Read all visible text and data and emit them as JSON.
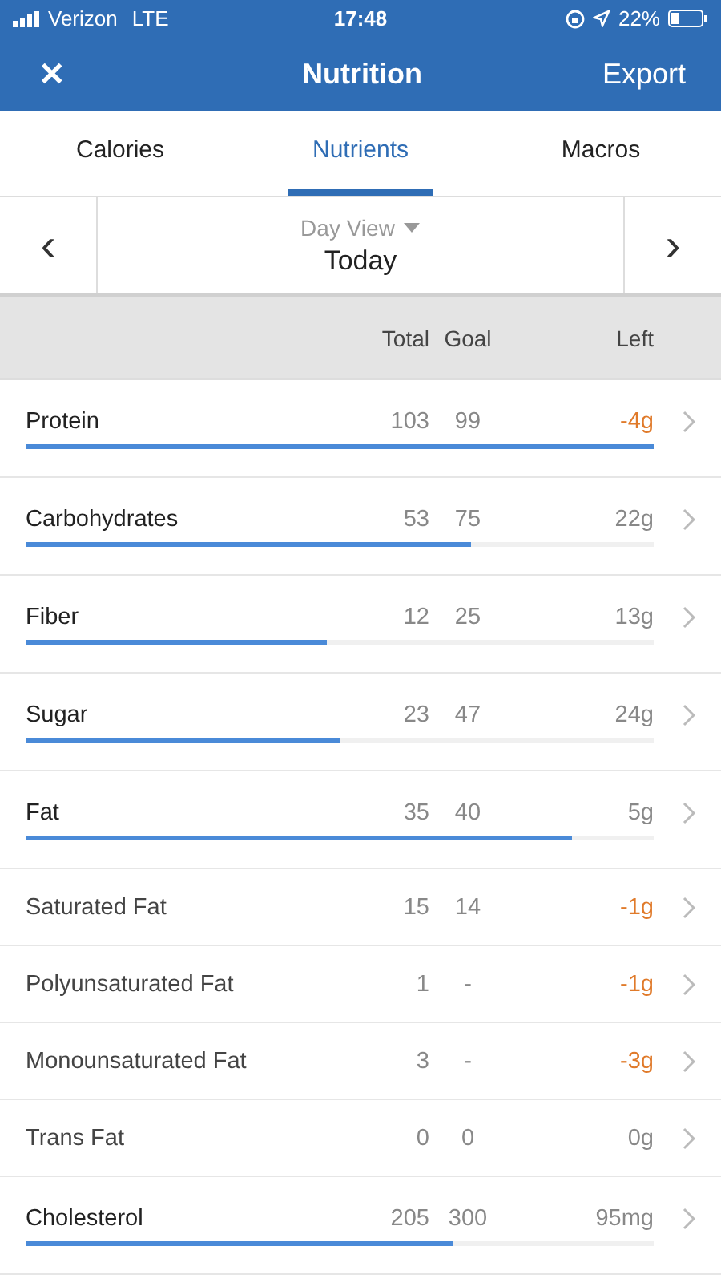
{
  "status_bar": {
    "carrier": "Verizon",
    "network": "LTE",
    "time": "17:48",
    "battery": "22%"
  },
  "header": {
    "close": "✕",
    "title": "Nutrition",
    "action": "Export"
  },
  "tabs": [
    {
      "label": "Calories",
      "selected": false
    },
    {
      "label": "Nutrients",
      "selected": true
    },
    {
      "label": "Macros",
      "selected": false
    }
  ],
  "date_nav": {
    "prev": "‹",
    "view": "Day View",
    "date": "Today",
    "next": "›"
  },
  "columns": [
    "Total",
    "Goal",
    "Left"
  ],
  "rows": [
    {
      "kind": "bar",
      "name": "Protein",
      "total": "103",
      "goal": "99",
      "left": "-4g",
      "over": true,
      "level": 1.0
    },
    {
      "kind": "bar",
      "name": "Carbohydrates",
      "total": "53",
      "goal": "75",
      "left": "22g",
      "over": false,
      "level": 0.71
    },
    {
      "kind": "bar",
      "name": "Fiber",
      "total": "12",
      "goal": "25",
      "left": "13g",
      "over": false,
      "level": 0.48
    },
    {
      "kind": "bar",
      "name": "Sugar",
      "total": "23",
      "goal": "47",
      "left": "24g",
      "over": false,
      "level": 0.5
    },
    {
      "kind": "bar",
      "name": "Fat",
      "total": "35",
      "goal": "40",
      "left": "5g",
      "over": false,
      "level": 0.87
    },
    {
      "kind": "plain",
      "name": "Saturated Fat",
      "total": "15",
      "goal": "14",
      "left": "-1g",
      "over": true
    },
    {
      "kind": "plain",
      "name": "Polyunsaturated Fat",
      "total": "1",
      "goal": "-",
      "left": "-1g",
      "over": true
    },
    {
      "kind": "plain",
      "name": "Monounsaturated Fat",
      "total": "3",
      "goal": "-",
      "left": "-3g",
      "over": true
    },
    {
      "kind": "plain",
      "name": "Trans Fat",
      "total": "0",
      "goal": "0",
      "left": "0g",
      "over": false
    },
    {
      "kind": "bar",
      "name": "Cholesterol",
      "total": "205",
      "goal": "300",
      "left": "95mg",
      "over": false,
      "level": 0.68
    }
  ]
}
